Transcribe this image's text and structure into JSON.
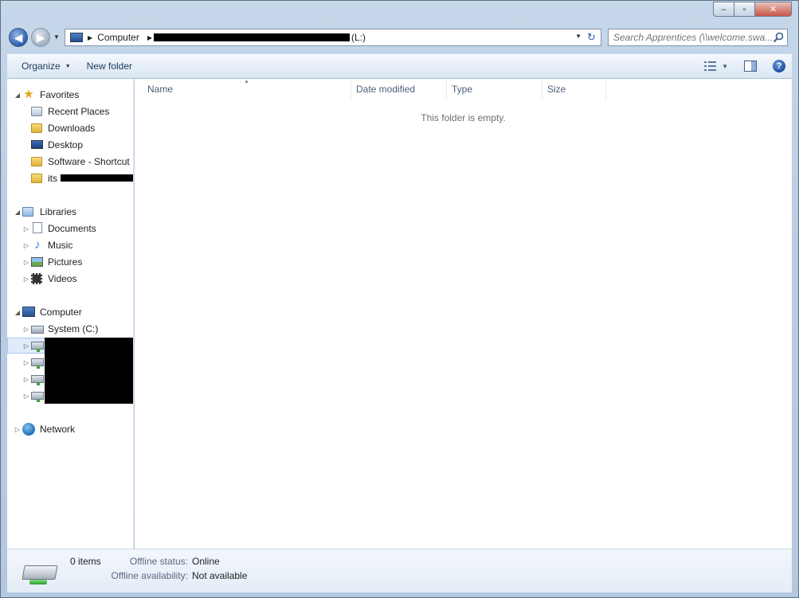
{
  "window": {
    "caption": {
      "minimize": "–",
      "maximize": "▫",
      "close": "✕"
    }
  },
  "address": {
    "root_label": "Computer",
    "drive_label": "(L:)",
    "refresh_glyph": "↻"
  },
  "search": {
    "placeholder": "Search Apprentices (\\\\welcome.swa..."
  },
  "commandbar": {
    "organize": "Organize",
    "new_folder": "New folder"
  },
  "navpane": {
    "favorites": {
      "label": "Favorites",
      "items": [
        {
          "label": "Recent Places",
          "icon": "recent-places-icon"
        },
        {
          "label": "Downloads",
          "icon": "downloads-folder-icon"
        },
        {
          "label": "Desktop",
          "icon": "desktop-icon"
        },
        {
          "label": "Software - Shortcut",
          "icon": "folder-icon"
        },
        {
          "label": "its",
          "icon": "folder-icon"
        }
      ]
    },
    "libraries": {
      "label": "Libraries",
      "items": [
        {
          "label": "Documents",
          "icon": "documents-icon"
        },
        {
          "label": "Music",
          "icon": "music-icon"
        },
        {
          "label": "Pictures",
          "icon": "pictures-icon"
        },
        {
          "label": "Videos",
          "icon": "videos-icon"
        }
      ]
    },
    "computer": {
      "label": "Computer",
      "items": [
        {
          "label": "System (C:)",
          "icon": "local-drive-icon"
        }
      ]
    },
    "network": {
      "label": "Network"
    }
  },
  "columns": [
    "Name",
    "Date modified",
    "Type",
    "Size"
  ],
  "content": {
    "empty_message": "This folder is empty."
  },
  "details": {
    "item_count": "0 items",
    "offline_status_label": "Offline status:",
    "offline_status_value": "Online",
    "offline_availability_label": "Offline availability:",
    "offline_availability_value": "Not available"
  },
  "colors": {
    "selection": "#dfeafa",
    "commandbar_text": "#1e395b",
    "frame": "#b7c9dd"
  }
}
